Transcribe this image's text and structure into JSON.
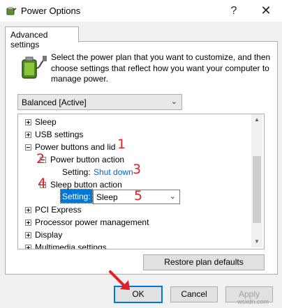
{
  "window": {
    "title": "Power Options",
    "help_glyph": "?",
    "close_glyph": "✕"
  },
  "tab": {
    "label": "Advanced settings"
  },
  "intro": {
    "text": "Select the power plan that you want to customize, and then choose settings that reflect how you want your computer to manage power."
  },
  "plan": {
    "value": "Balanced [Active]"
  },
  "tree": {
    "sleep": "Sleep",
    "usb": "USB settings",
    "power_buttons": "Power buttons and lid",
    "power_button_action": "Power button action",
    "setting_label": "Setting:",
    "shutdown_value": "Shut down",
    "sleep_button_action": "Sleep button action",
    "setting_label_2": "Setting:",
    "sleep_value": "Sleep",
    "pci": "PCI Express",
    "processor": "Processor power management",
    "display": "Display",
    "multimedia": "Multimedia settings"
  },
  "annotations": {
    "n1": "1",
    "n2": "2",
    "n3": "3",
    "n4": "4",
    "n5": "5"
  },
  "buttons": {
    "restore": "Restore plan defaults",
    "ok": "OK",
    "cancel": "Cancel",
    "apply": "Apply"
  },
  "watermark": "wsxdn.com",
  "colors": {
    "link": "#0066cc",
    "annotation_red": "#e0202a",
    "selection_blue": "#0078d7"
  }
}
